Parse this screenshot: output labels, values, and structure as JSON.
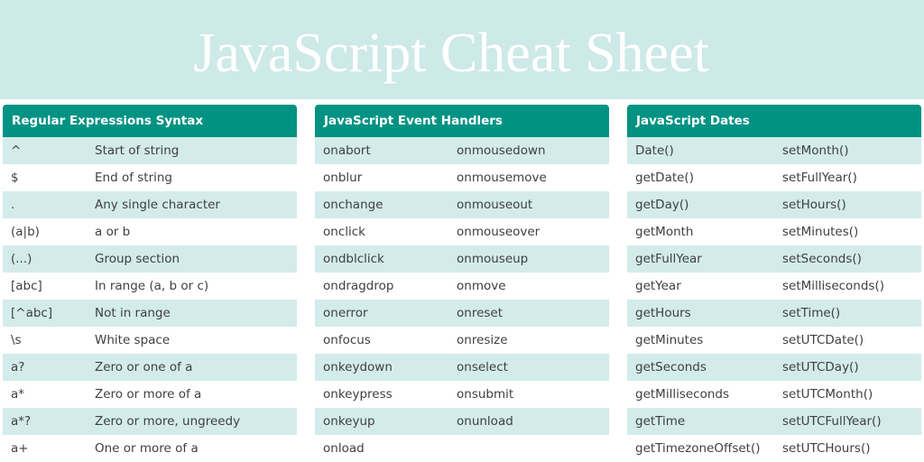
{
  "title": "JavaScript Cheat Sheet",
  "colors": {
    "banner": "#cde9e8",
    "header": "#009283",
    "row_alt": "#d3eceb",
    "text": "#3f3f3f"
  },
  "panels": [
    {
      "heading": "Regular Expressions Syntax",
      "rows": [
        [
          "^",
          "Start of string"
        ],
        [
          "$",
          "End of string"
        ],
        [
          ".",
          "Any single character"
        ],
        [
          "(a|b)",
          "a or b"
        ],
        [
          "(...)",
          "Group section"
        ],
        [
          "[abc]",
          "In range (a, b or c)"
        ],
        [
          "[^abc]",
          "Not in range"
        ],
        [
          "\\s",
          "White space"
        ],
        [
          "a?",
          "Zero or one of a"
        ],
        [
          "a*",
          "Zero or more of a"
        ],
        [
          "a*?",
          "Zero or more, ungreedy"
        ],
        [
          "a+",
          "One or more of a"
        ]
      ]
    },
    {
      "heading": "JavaScript Event Handlers",
      "rows": [
        [
          "onabort",
          "onmousedown"
        ],
        [
          "onblur",
          "onmousemove"
        ],
        [
          "onchange",
          "onmouseout"
        ],
        [
          "onclick",
          "onmouseover"
        ],
        [
          "ondblclick",
          "onmouseup"
        ],
        [
          "ondragdrop",
          "onmove"
        ],
        [
          "onerror",
          "onreset"
        ],
        [
          "onfocus",
          "onresize"
        ],
        [
          "onkeydown",
          "onselect"
        ],
        [
          "onkeypress",
          "onsubmit"
        ],
        [
          "onkeyup",
          "onunload"
        ],
        [
          "onload",
          ""
        ]
      ]
    },
    {
      "heading": "JavaScript Dates",
      "rows": [
        [
          "Date()",
          "setMonth()"
        ],
        [
          "getDate()",
          "setFullYear()"
        ],
        [
          "getDay()",
          "setHours()"
        ],
        [
          "getMonth",
          "setMinutes()"
        ],
        [
          "getFullYear",
          "setSeconds()"
        ],
        [
          "getYear",
          "setMilliseconds()"
        ],
        [
          "getHours",
          "setTime()"
        ],
        [
          "getMinutes",
          "setUTCDate()"
        ],
        [
          "getSeconds",
          "setUTCDay()"
        ],
        [
          "getMilliseconds",
          "setUTCMonth()"
        ],
        [
          "getTime",
          "setUTCFullYear()"
        ],
        [
          "getTimezoneOffset()",
          "setUTCHours()"
        ]
      ]
    }
  ]
}
